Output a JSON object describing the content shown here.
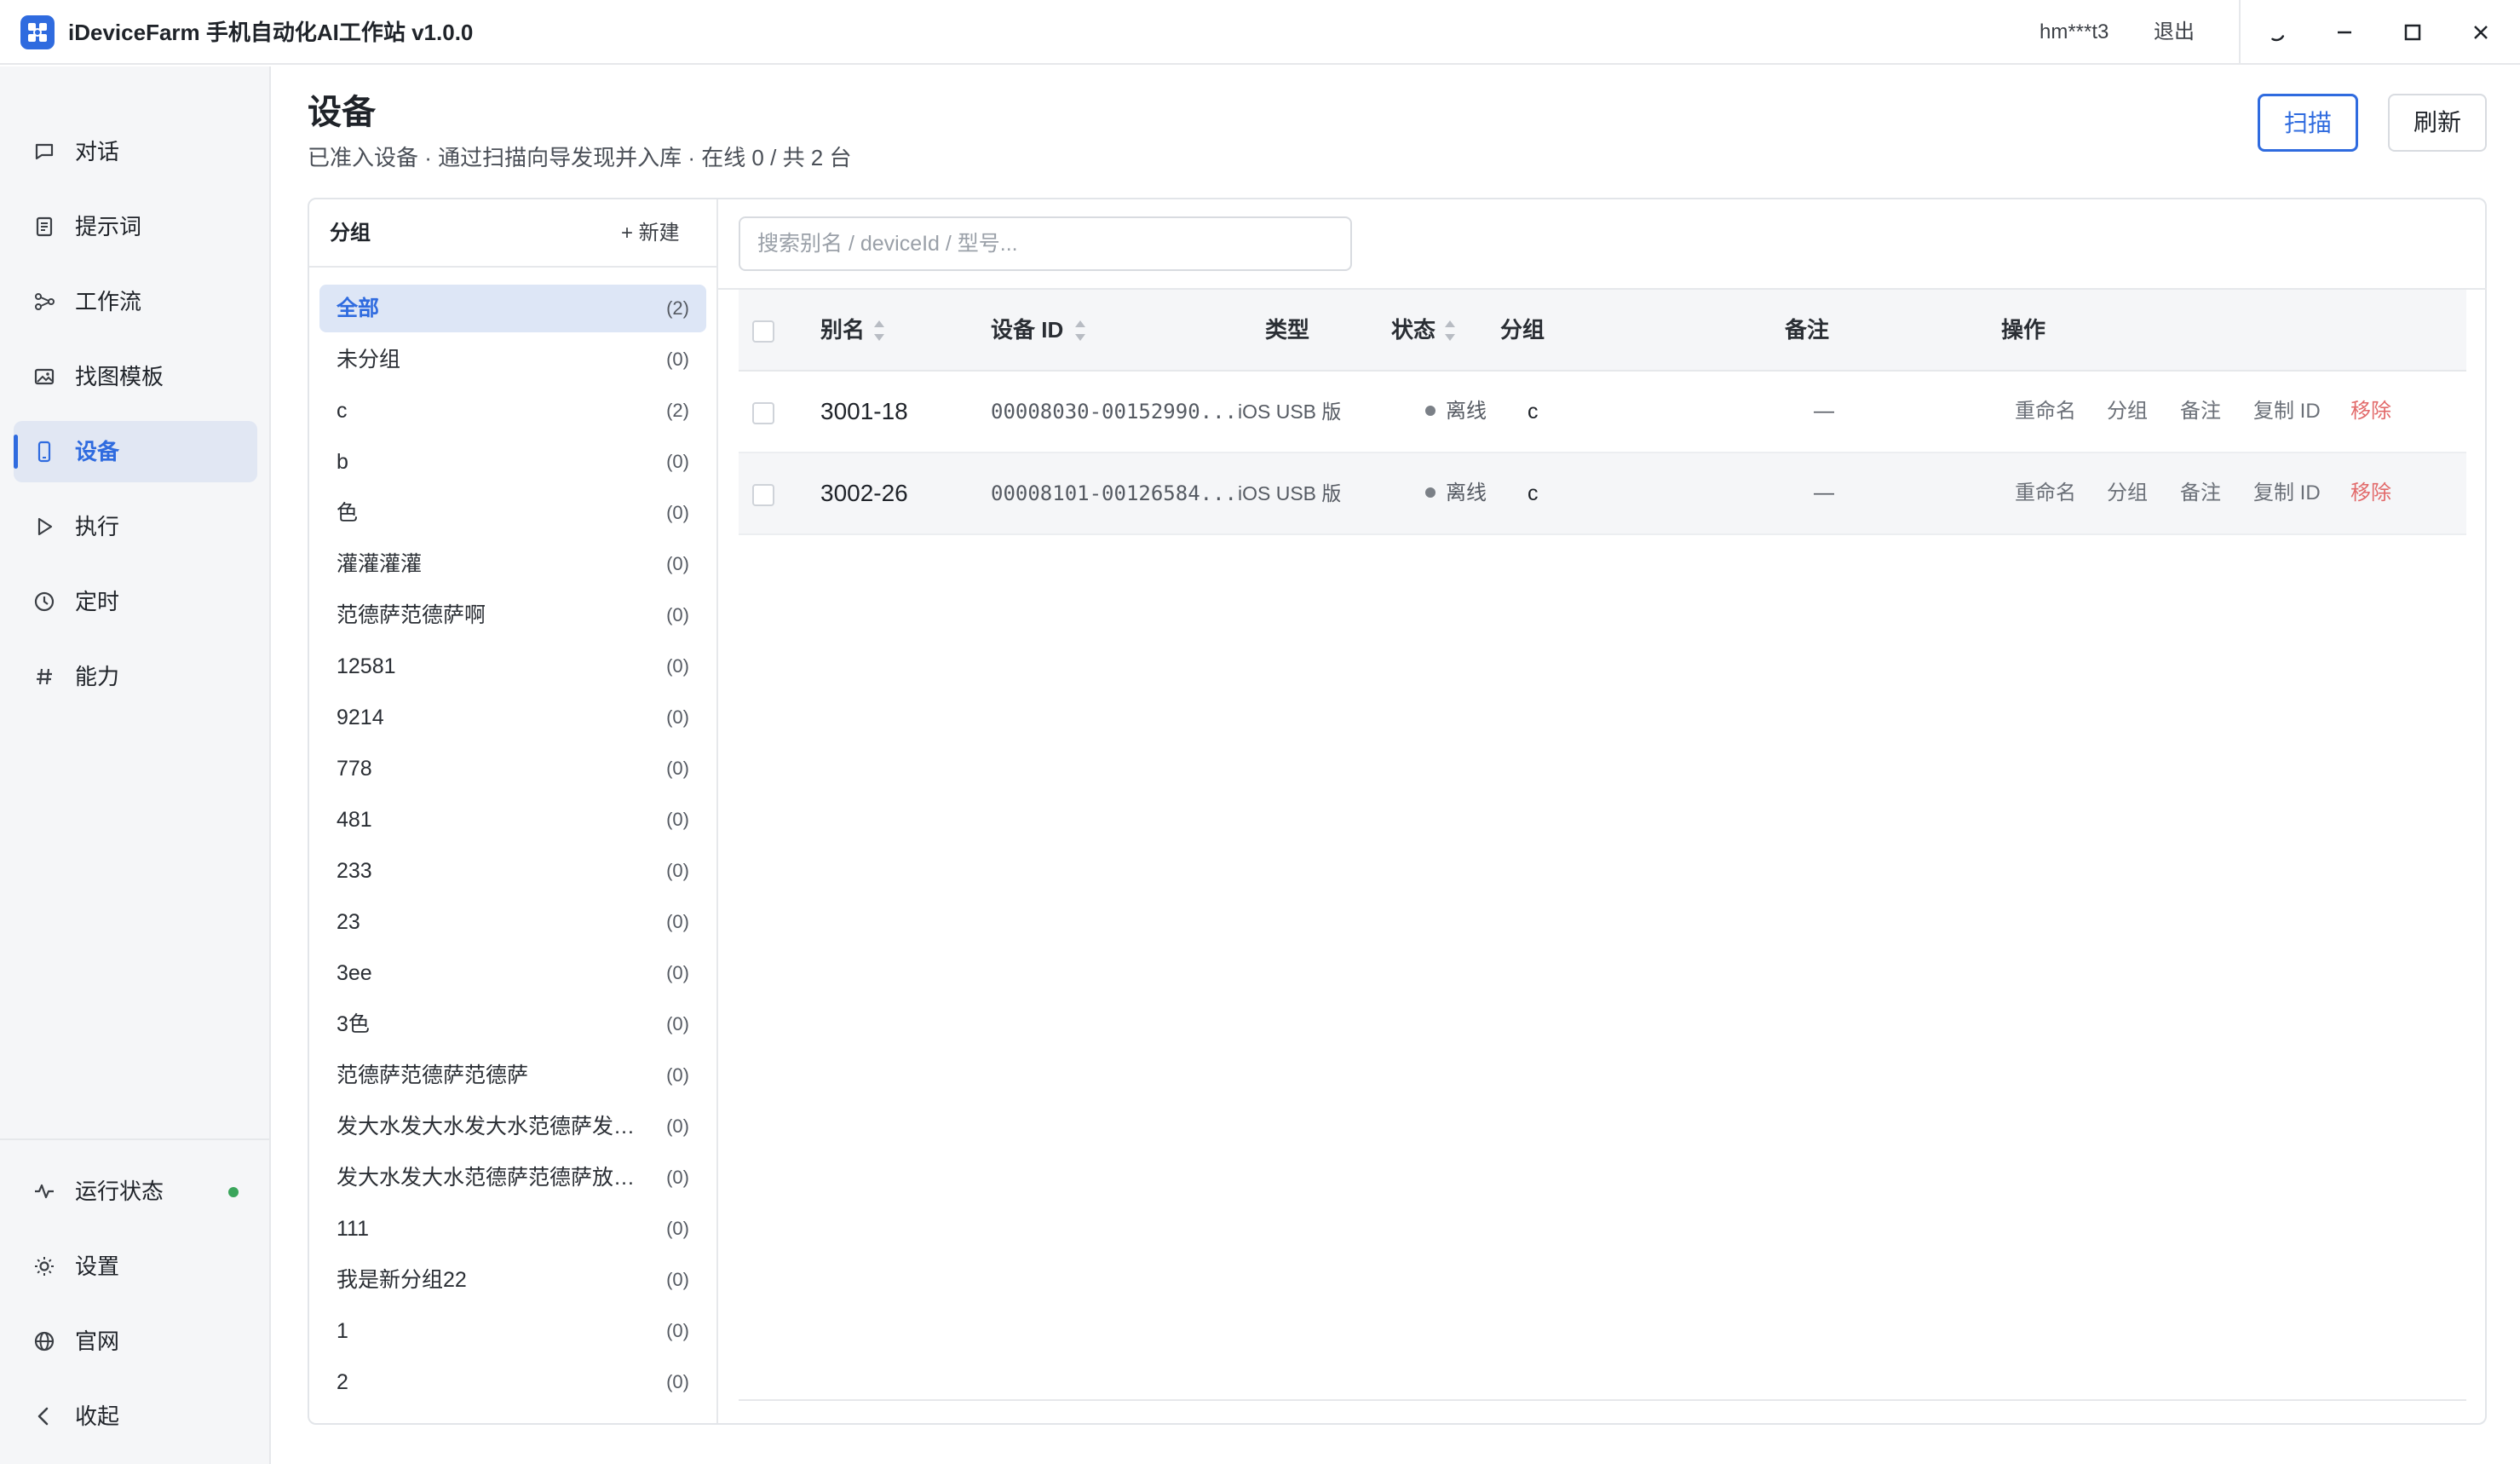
{
  "app": {
    "title": "iDeviceFarm 手机自动化AI工作站 v1.0.0",
    "user": "hm***t3",
    "logout": "退出"
  },
  "colors": {
    "accent": "#2f6bdf",
    "danger": "#e26a6a",
    "online": "#3aa55b",
    "offline": "#7b8087"
  },
  "sidebar": {
    "items": [
      {
        "label": "对话",
        "icon": "chat-icon"
      },
      {
        "label": "提示词",
        "icon": "document-icon"
      },
      {
        "label": "工作流",
        "icon": "workflow-icon"
      },
      {
        "label": "找图模板",
        "icon": "image-icon"
      },
      {
        "label": "设备",
        "icon": "phone-icon",
        "active": true
      },
      {
        "label": "执行",
        "icon": "play-icon"
      },
      {
        "label": "定时",
        "icon": "clock-icon"
      },
      {
        "label": "能力",
        "icon": "hash-icon"
      }
    ],
    "bottom": [
      {
        "label": "运行状态",
        "icon": "activity-icon"
      },
      {
        "label": "设置",
        "icon": "sun-icon"
      },
      {
        "label": "官网",
        "icon": "globe-icon"
      },
      {
        "label": "收起",
        "icon": "chevron-left-icon"
      }
    ]
  },
  "page": {
    "title": "设备",
    "subtitle": "已准入设备 · 通过扫描向导发现并入库 · 在线 0 / 共 2 台",
    "scan_label": "扫描",
    "refresh_label": "刷新"
  },
  "groups": {
    "title": "分组",
    "new_label": "+ 新建",
    "items": [
      {
        "name": "全部",
        "count": "(2)",
        "active": true
      },
      {
        "name": "未分组",
        "count": "(0)"
      },
      {
        "name": "c",
        "count": "(2)"
      },
      {
        "name": "b",
        "count": "(0)"
      },
      {
        "name": "色",
        "count": "(0)"
      },
      {
        "name": "灌灌灌灌",
        "count": "(0)"
      },
      {
        "name": "范德萨范德萨啊",
        "count": "(0)"
      },
      {
        "name": "12581",
        "count": "(0)"
      },
      {
        "name": "9214",
        "count": "(0)"
      },
      {
        "name": "778",
        "count": "(0)"
      },
      {
        "name": "481",
        "count": "(0)"
      },
      {
        "name": "233",
        "count": "(0)"
      },
      {
        "name": "23",
        "count": "(0)"
      },
      {
        "name": "3ee",
        "count": "(0)"
      },
      {
        "name": "3色",
        "count": "(0)"
      },
      {
        "name": "范德萨范德萨范德萨",
        "count": "(0)"
      },
      {
        "name": "发大水发大水发大水范德萨发大水发大水",
        "count": "(0)"
      },
      {
        "name": "发大水发大水范德萨范德萨放大水发",
        "count": "(0)"
      },
      {
        "name": "111",
        "count": "(0)"
      },
      {
        "name": "我是新分组22",
        "count": "(0)"
      },
      {
        "name": "1",
        "count": "(0)"
      },
      {
        "name": "2",
        "count": "(0)"
      }
    ]
  },
  "devices": {
    "search_placeholder": "搜索别名 / deviceId / 型号...",
    "columns": {
      "alias": "别名",
      "device_id": "设备 ID",
      "type": "类型",
      "status": "状态",
      "group": "分组",
      "note": "备注",
      "actions": "操作"
    },
    "actions": {
      "rename": "重命名",
      "group": "分组",
      "note": "备注",
      "copy_id": "复制 ID",
      "remove": "移除"
    },
    "rows": [
      {
        "alias": "3001-18",
        "device_id": "00008030-00152990...",
        "type": "iOS USB 版",
        "status": "离线",
        "group": "c",
        "note": "—"
      },
      {
        "alias": "3002-26",
        "device_id": "00008101-00126584...",
        "type": "iOS USB 版",
        "status": "离线",
        "group": "c",
        "note": "—"
      }
    ]
  }
}
